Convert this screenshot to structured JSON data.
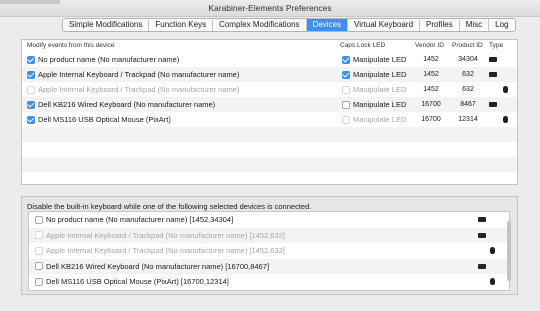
{
  "window": {
    "title": "Karabiner-Elements Preferences",
    "tabs": [
      {
        "label": "Simple Modifications",
        "active": false
      },
      {
        "label": "Function Keys",
        "active": false
      },
      {
        "label": "Complex Modifications",
        "active": false
      },
      {
        "label": "Devices",
        "active": true
      },
      {
        "label": "Virtual Keyboard",
        "active": false
      },
      {
        "label": "Profiles",
        "active": false
      },
      {
        "label": "Misc",
        "active": false
      },
      {
        "label": "Log",
        "active": false
      }
    ]
  },
  "devices_table": {
    "headers": {
      "modify": "Modify events from this device",
      "caps_lock": "Caps Lock LED",
      "vendor_id": "Vendor ID",
      "product_id": "Product ID",
      "type": "Type"
    },
    "rows": [
      {
        "name": "No product name (No manufacturer name)",
        "modify_checked": true,
        "disabled": false,
        "led_label": "Manipulate LED",
        "led_checked": true,
        "led_disabled": false,
        "vendor_id": "1452",
        "product_id": "34304",
        "type_icon": "keyboard-icon"
      },
      {
        "name": "Apple Internal Keyboard / Trackpad (No manufacturer name)",
        "modify_checked": true,
        "disabled": false,
        "led_label": "Manipulate LED",
        "led_checked": true,
        "led_disabled": false,
        "vendor_id": "1452",
        "product_id": "632",
        "type_icon": "keyboard-icon"
      },
      {
        "name": "Apple Internal Keyboard / Trackpad (No manufacturer name)",
        "modify_checked": false,
        "disabled": true,
        "led_label": "Manipulate LED",
        "led_checked": false,
        "led_disabled": true,
        "vendor_id": "1452",
        "product_id": "632",
        "type_icon": "mouse-icon"
      },
      {
        "name": "Dell KB216 Wired Keyboard (No manufacturer name)",
        "modify_checked": true,
        "disabled": false,
        "led_label": "Manipulate LED",
        "led_checked": false,
        "led_disabled": false,
        "vendor_id": "16700",
        "product_id": "8467",
        "type_icon": "keyboard-icon"
      },
      {
        "name": "Dell MS116 USB Optical Mouse (PixArt)",
        "modify_checked": true,
        "disabled": false,
        "led_label": "Manipulate LED",
        "led_checked": false,
        "led_disabled": true,
        "vendor_id": "16700",
        "product_id": "12314",
        "type_icon": "mouse-icon"
      }
    ]
  },
  "builtin_section": {
    "heading": "Disable the built-in keyboard while one of the following selected devices is connected.",
    "items": [
      {
        "label": "No product name (No manufacturer name) [1452,34304]",
        "checked": false,
        "disabled": false,
        "type_icon": "keyboard-icon"
      },
      {
        "label": "Apple Internal Keyboard / Trackpad (No manufacturer name) [1452,632]",
        "checked": false,
        "disabled": true,
        "type_icon": "keyboard-icon"
      },
      {
        "label": "Apple Internal Keyboard / Trackpad (No manufacturer name) [1452,632]",
        "checked": false,
        "disabled": true,
        "type_icon": "mouse-icon"
      },
      {
        "label": "Dell KB216 Wired Keyboard (No manufacturer name) [16700,8467]",
        "checked": false,
        "disabled": false,
        "type_icon": "keyboard-icon"
      },
      {
        "label": "Dell MS116 USB Optical Mouse (PixArt) [16700,12314]",
        "checked": false,
        "disabled": false,
        "type_icon": "mouse-icon"
      }
    ]
  },
  "colors": {
    "accent": "#3b8ff5"
  }
}
